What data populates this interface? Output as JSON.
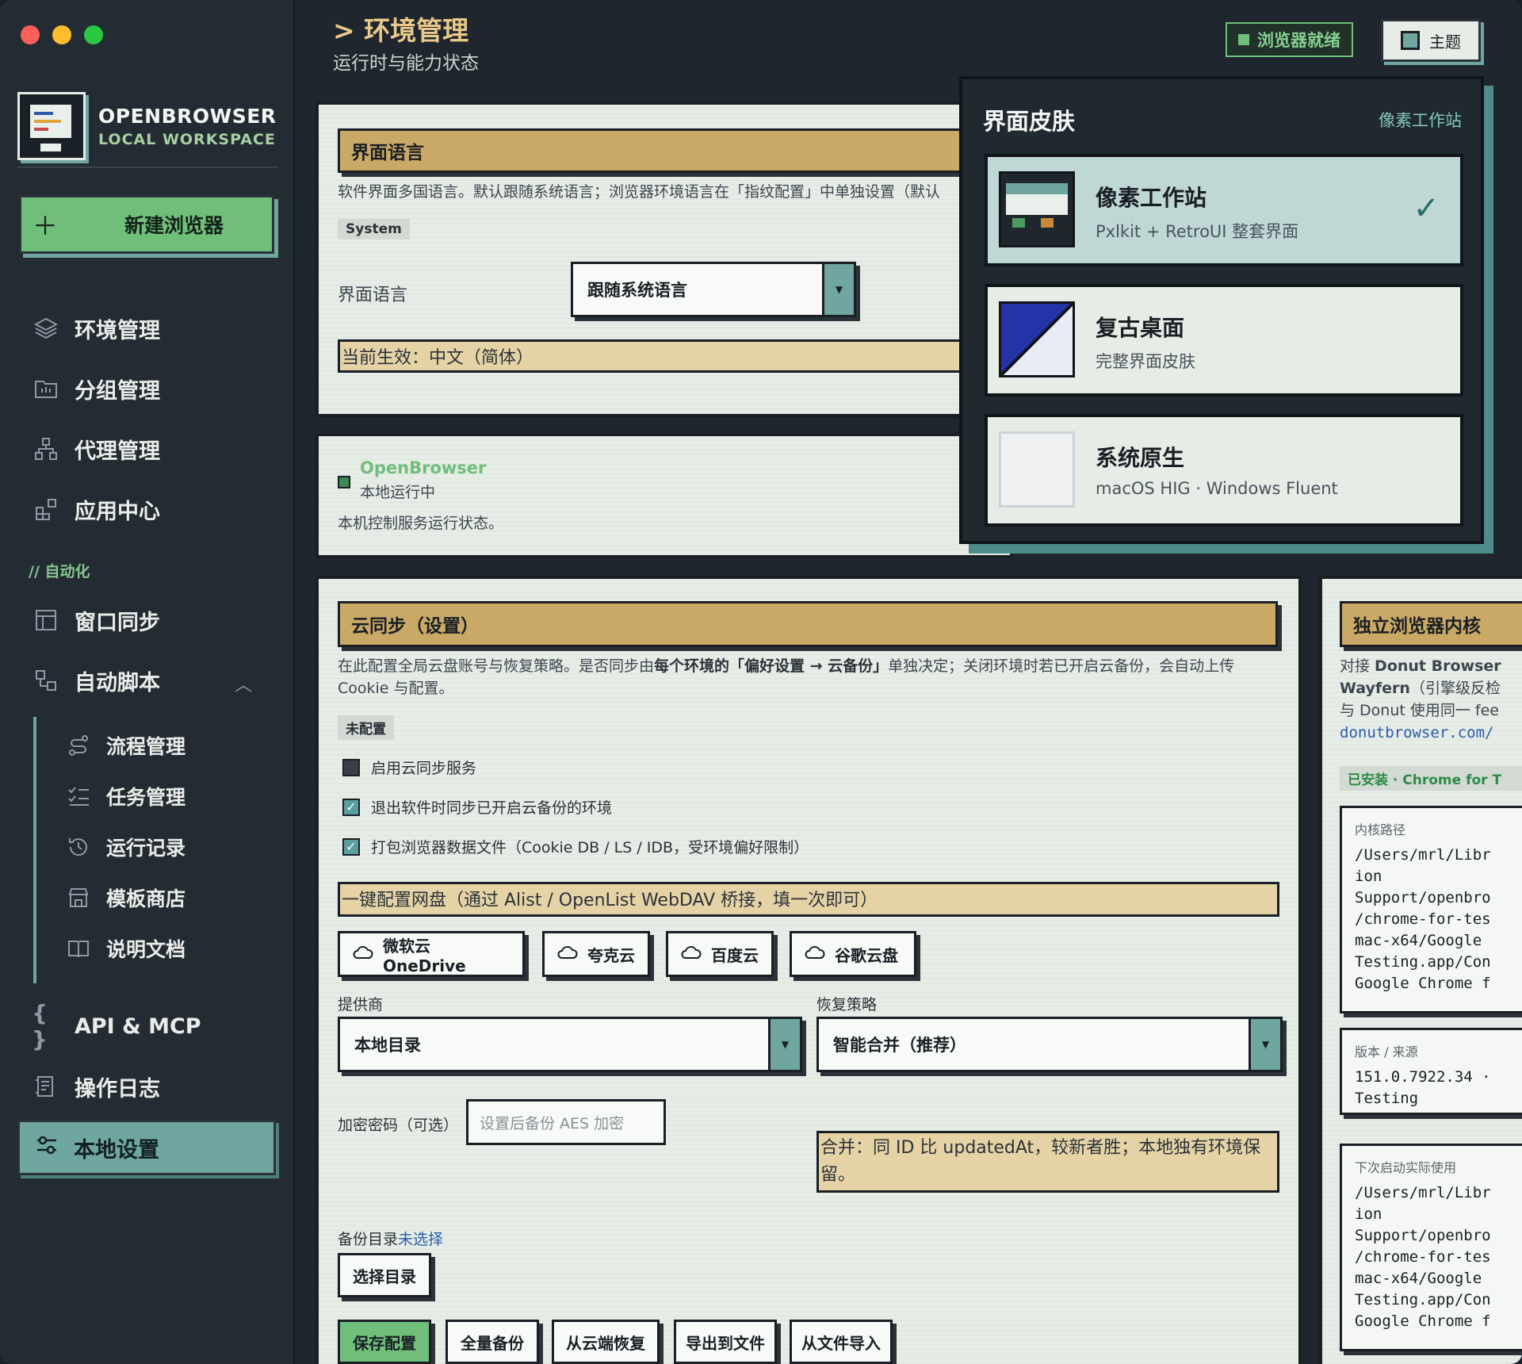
{
  "window": {
    "traffic_colors": [
      "#fe5f57",
      "#febc2e",
      "#28c840"
    ]
  },
  "brand": {
    "title": "OPENBROWSER",
    "subtitle": "LOCAL WORKSPACE"
  },
  "sidebar": {
    "new_button": {
      "icon": "plus-icon",
      "label": "新建浏览器"
    },
    "items": [
      {
        "icon": "layers-icon",
        "label": "环境管理"
      },
      {
        "icon": "folder-icon",
        "label": "分组管理"
      },
      {
        "icon": "network-icon",
        "label": "代理管理"
      },
      {
        "icon": "apps-icon",
        "label": "应用中心"
      }
    ],
    "section_label": "// 自动化",
    "automation": [
      {
        "icon": "window-icon",
        "label": "窗口同步"
      },
      {
        "icon": "script-icon",
        "label": "自动脚本"
      }
    ],
    "sub_items": [
      {
        "icon": "flow-icon",
        "label": "流程管理"
      },
      {
        "icon": "task-list-icon",
        "label": "任务管理"
      },
      {
        "icon": "history-icon",
        "label": "运行记录"
      },
      {
        "icon": "store-icon",
        "label": "模板商店"
      },
      {
        "icon": "book-icon",
        "label": "说明文档"
      }
    ],
    "bottom": [
      {
        "icon": "braces-icon",
        "label": "API & MCP"
      },
      {
        "icon": "log-icon",
        "label": "操作日志"
      }
    ],
    "active": {
      "icon": "settings-sliders-icon",
      "label": "本地设置"
    }
  },
  "header": {
    "title": "> 环境管理",
    "subtitle": "运行时与能力状态",
    "ready_badge": "浏览器就绪",
    "theme_button": "主题"
  },
  "language": {
    "bar_title": "界面语言",
    "description": "软件界面多国语言。默认跟随系统语言；浏览器环境语言在「指纹配置」中单独设置（默认",
    "tag": "System",
    "field_label": "界面语言",
    "select_value": "跟随系统语言",
    "current": "当前生效：中文（简体）"
  },
  "status": {
    "name": "OpenBrowser",
    "state": "本地运行中",
    "description": "本机控制服务运行状态。"
  },
  "cloud": {
    "bar_title": "云同步（设置）",
    "description_1a": "在此配置全局云盘账号与恢复策略。是否同步由",
    "description_1b": "每个环境的「偏好设置 → 云备份」",
    "description_1c": "单独决定；关闭环境时若已开启云备份，会自动上传",
    "description_2": "Cookie 与配置。",
    "tag": "未配置",
    "checkboxes": [
      {
        "label": "启用云同步服务",
        "checked": false
      },
      {
        "label": "退出软件时同步已开启云备份的环境",
        "checked": true
      },
      {
        "label": "打包浏览器数据文件（Cookie DB / LS / IDB，受环境偏好限制）",
        "checked": true
      }
    ],
    "quick_setup": "一键配置网盘（通过 Alist / OpenList WebDAV 桥接，填一次即可）",
    "providers": [
      {
        "icon": "cloud-icon",
        "label": "微软云 OneDrive"
      },
      {
        "icon": "cloud-icon",
        "label": "夸克云"
      },
      {
        "icon": "cloud-icon",
        "label": "百度云"
      },
      {
        "icon": "cloud-icon",
        "label": "谷歌云盘"
      }
    ],
    "provider_label": "提供商",
    "provider_value": "本地目录",
    "strategy_label": "恢复策略",
    "strategy_value": "智能合并（推荐）",
    "password_label": "加密密码（可选）",
    "password_placeholder": "设置后备份 AES 加密",
    "merge_note": "合并：同 ID 比 updatedAt，较新者胜；本地独有环境保留。",
    "backup_dir_label": "备份目录",
    "backup_dir_value": "未选择",
    "choose_dir": "选择目录",
    "actions": [
      "保存配置",
      "全量备份",
      "从云端恢复",
      "导出到文件",
      "从文件导入"
    ]
  },
  "kernel": {
    "bar_title": "独立浏览器内核",
    "line1a": "对接 ",
    "line1b": "Donut Browser",
    "line2a": "Wayfern",
    "line2b": "（引擎级反检",
    "line3": "与 Donut 使用同一 fee",
    "link": "donutbrowser.com/",
    "installed": "已安装 · Chrome for T",
    "path_label": "内核路径",
    "path_value": "/Users/mrl/Libr\nion\nSupport/openbro\n/chrome-for-tes\nmac-x64/Google\nTesting.app/Con\nGoogle Chrome f",
    "version_label": "版本 / 来源",
    "version_value": "151.0.7922.34 ·\nTesting",
    "next_label": "下次启动实际使用",
    "next_value": "/Users/mrl/Libr\nion\nSupport/openbro\n/chrome-for-tes\nmac-x64/Google\nTesting.app/Con\nGoogle Chrome f"
  },
  "skin_popover": {
    "title": "界面皮肤",
    "current": "像素工作站",
    "options": [
      {
        "name": "像素工作站",
        "sub": "Pxlkit + RetroUI 整套界面",
        "selected": true
      },
      {
        "name": "复古桌面",
        "sub": "完整界面皮肤",
        "selected": false
      },
      {
        "name": "系统原生",
        "sub": "macOS HIG · Windows Fluent",
        "selected": false
      }
    ]
  }
}
